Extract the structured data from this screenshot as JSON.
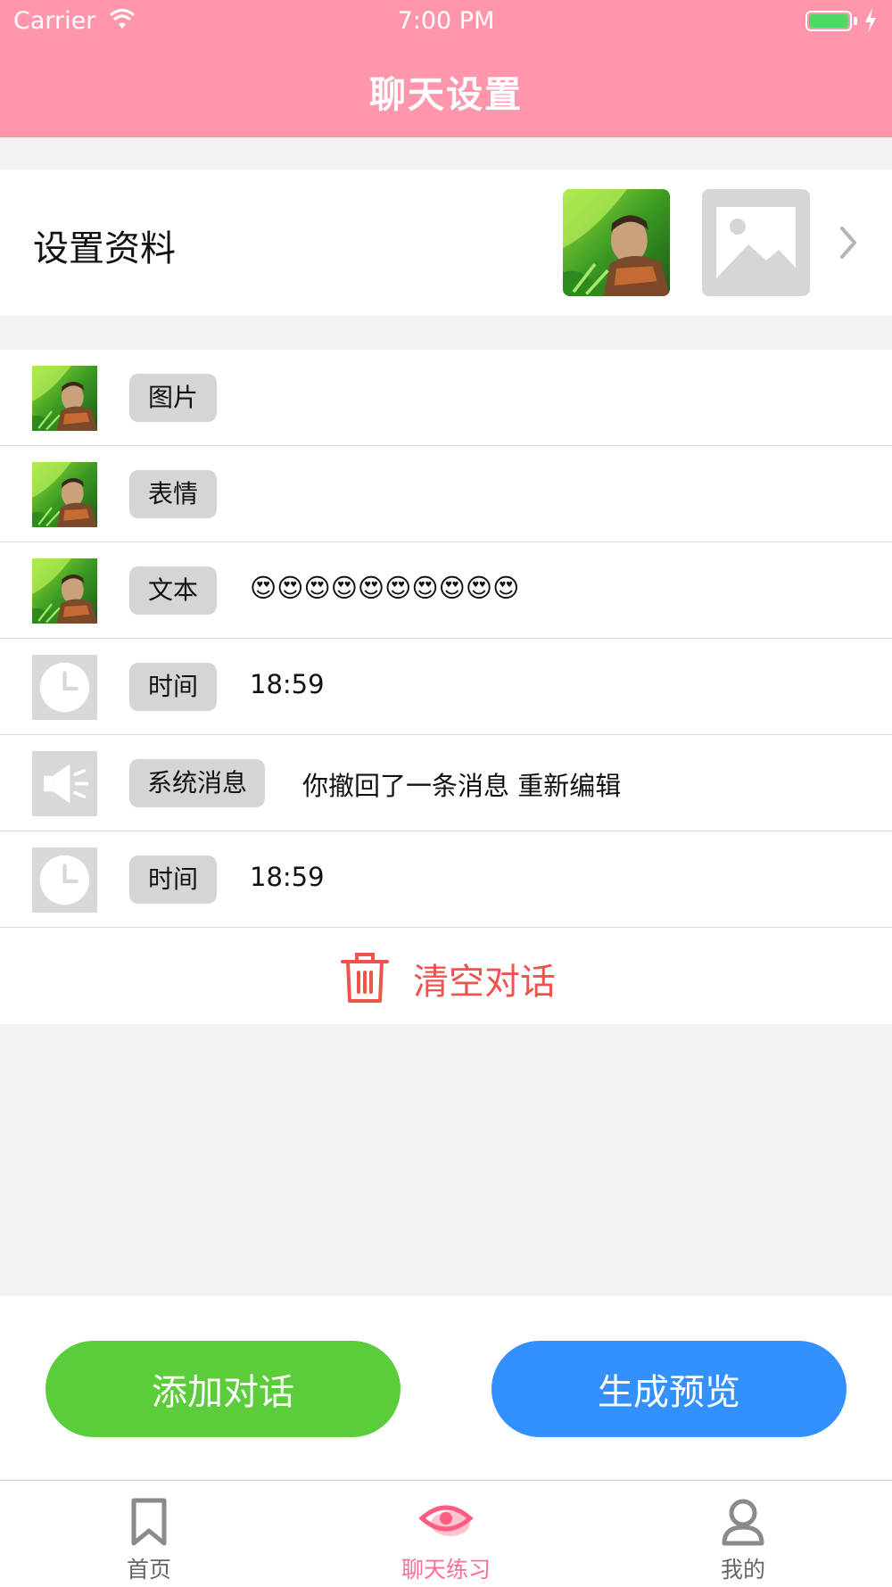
{
  "status_bar": {
    "carrier": "Carrier",
    "time": "7:00 PM"
  },
  "nav": {
    "title": "聊天设置"
  },
  "profile": {
    "label": "设置资料"
  },
  "rows": [
    {
      "type": "图片",
      "text": ""
    },
    {
      "type": "表情",
      "text": ""
    },
    {
      "type": "文本",
      "text": "😍😍😍😍😍😍😍😍😍😍"
    },
    {
      "type": "时间",
      "text": "18:59"
    },
    {
      "type": "系统消息",
      "text": "你撤回了一条消息 重新编辑"
    },
    {
      "type": "时间",
      "text": "18:59"
    }
  ],
  "clear": {
    "label": "清空对话"
  },
  "actions": {
    "add_label": "添加对话",
    "preview_label": "生成预览"
  },
  "tabs": [
    {
      "label": "首页",
      "icon": "bookmark-icon"
    },
    {
      "label": "聊天练习",
      "icon": "eye-icon"
    },
    {
      "label": "我的",
      "icon": "user-icon"
    }
  ],
  "colors": {
    "brand": "#ff96ab",
    "green": "#5bcc3a",
    "blue": "#3391ff",
    "danger": "#f0534e",
    "tab_active": "#ff6f93"
  }
}
